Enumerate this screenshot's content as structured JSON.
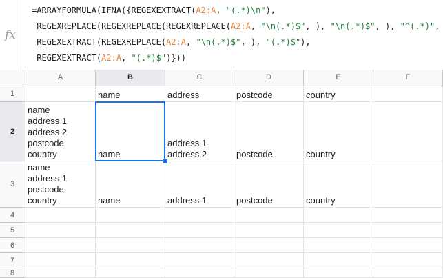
{
  "formula_bar": {
    "fx_label": "fx",
    "lines": [
      [
        {
          "t": "=ARRAYFORMULA(IFNA({REGEXEXTRACT(",
          "c": "d"
        },
        {
          "t": "A2:A",
          "c": "r"
        },
        {
          "t": ", ",
          "c": "d"
        },
        {
          "t": "\"(.*)\\n\"",
          "c": "s"
        },
        {
          "t": "),",
          "c": "d"
        }
      ],
      [
        {
          "t": " REGEXREPLACE(REGEXREPLACE(REGEXREPLACE(",
          "c": "d"
        },
        {
          "t": "A2:A",
          "c": "r"
        },
        {
          "t": ", ",
          "c": "d"
        },
        {
          "t": "\"\\n(.*)$\"",
          "c": "s"
        },
        {
          "t": ", ), ",
          "c": "d"
        },
        {
          "t": "\"\\n(.*)$\"",
          "c": "s"
        },
        {
          "t": ", ), ",
          "c": "d"
        },
        {
          "t": "\"^(.*)\"",
          "c": "s"
        },
        {
          "t": ", ),",
          "c": "d"
        }
      ],
      [
        {
          "t": " REGEXEXTRACT(REGEXREPLACE(",
          "c": "d"
        },
        {
          "t": "A2:A",
          "c": "r"
        },
        {
          "t": ", ",
          "c": "d"
        },
        {
          "t": "\"\\n(.*)$\"",
          "c": "s"
        },
        {
          "t": ", ), ",
          "c": "d"
        },
        {
          "t": "\"(.*)$\"",
          "c": "s"
        },
        {
          "t": "),",
          "c": "d"
        }
      ],
      [
        {
          "t": " REGEXEXTRACT(",
          "c": "d"
        },
        {
          "t": "A2:A",
          "c": "r"
        },
        {
          "t": ", ",
          "c": "d"
        },
        {
          "t": "\"(.*)$\"",
          "c": "s"
        },
        {
          "t": ")}))",
          "c": "d"
        }
      ]
    ]
  },
  "columns": [
    "A",
    "B",
    "C",
    "D",
    "E",
    "F"
  ],
  "rows": [
    "1",
    "2",
    "3",
    "4",
    "5",
    "6",
    "7",
    "8"
  ],
  "selected": {
    "col": "B",
    "row": "2"
  },
  "cells": {
    "B1": "name",
    "C1": "address",
    "D1": "postcode",
    "E1": "country",
    "A2": "name\naddress 1\naddress 2\npostcode\ncountry",
    "B2": "name",
    "C2": "address 1\naddress 2",
    "D2": "postcode",
    "E2": "country",
    "A3": "name\naddress 1\npostcode\ncountry",
    "B3": "name",
    "C3": "address 1",
    "D3": "postcode",
    "E3": "country"
  },
  "colors": {
    "range": "#e8833a",
    "string": "#188038",
    "selection": "#1a73e8"
  }
}
